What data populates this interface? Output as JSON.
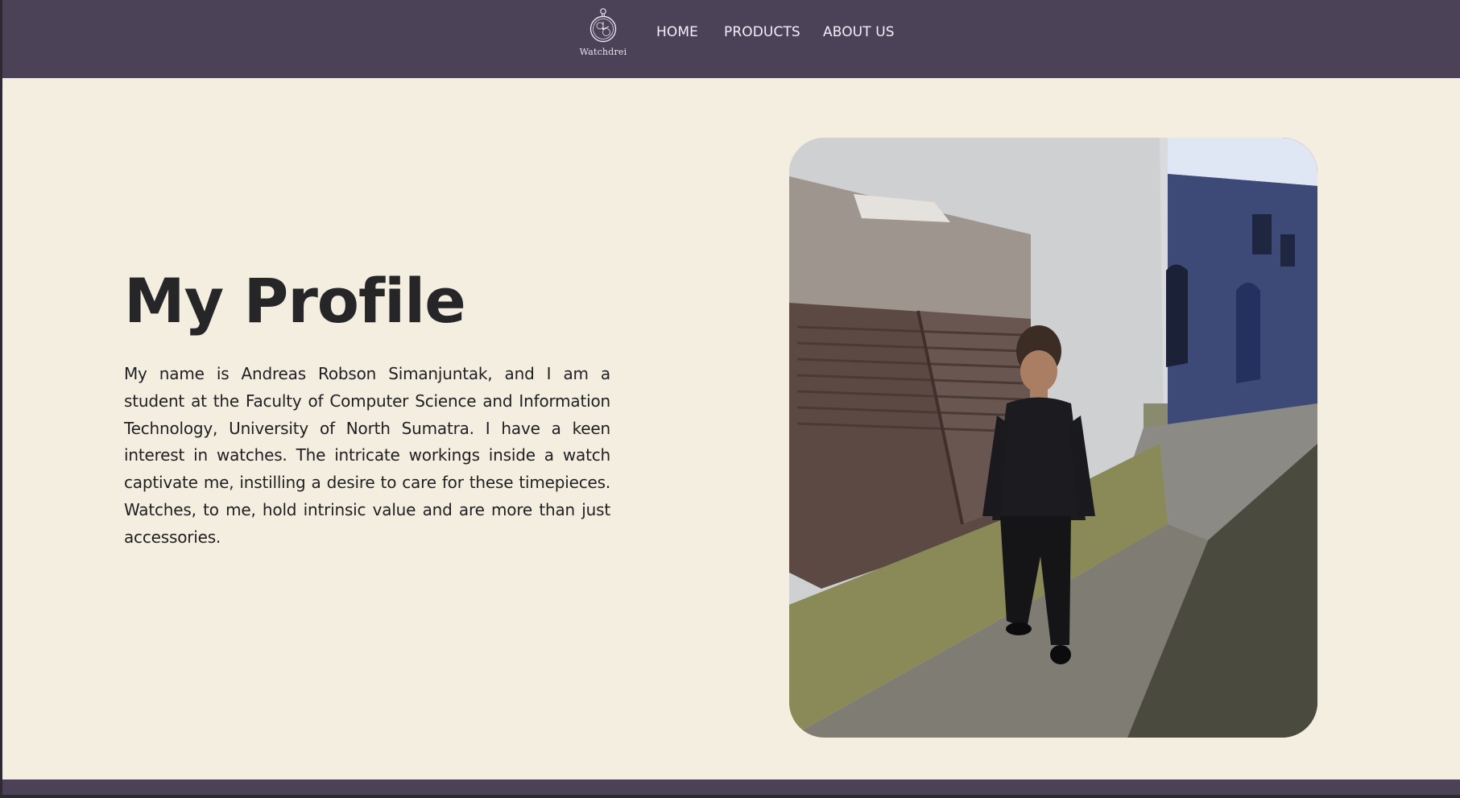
{
  "navbar": {
    "brand_name": "Watchdrei",
    "brand_icon": "pocket-watch-icon",
    "links": [
      {
        "label": "HOME"
      },
      {
        "label": "PRODUCTS"
      },
      {
        "label": "ABOUT US"
      }
    ]
  },
  "profile": {
    "title": "My Profile",
    "bio": "My name is Andreas Robson Simanjuntak, and I am a student at the Faculty of Computer Science and Information Technology, University of North Sumatra. I have a keen interest in watches. The intricate workings inside a watch captivate me, instilling a desire to care for these timepieces. Watches, to me, hold intrinsic value and are more than just accessories."
  },
  "colors": {
    "navbar_bg": "#4b4257",
    "main_bg": "#f4eee1",
    "nav_text": "#f4eefa",
    "heading_text": "#262629"
  }
}
